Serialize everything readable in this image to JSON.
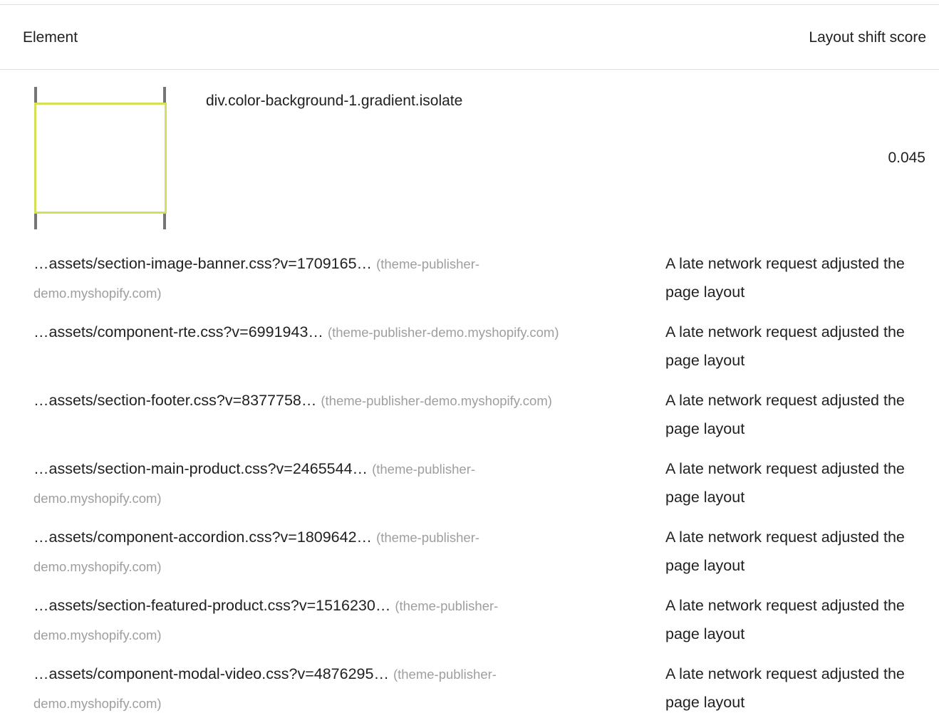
{
  "header": {
    "element_label": "Element",
    "score_label": "Layout shift score"
  },
  "element": {
    "selector": "div.color-background-1.gradient.isolate",
    "score": "0.045",
    "highlight_color": "#d4e157"
  },
  "rows": [
    {
      "url": "…assets/section-image-banner.css?v=1709165…",
      "origin": "(theme-publisher-demo.myshopify.com)",
      "reason": "A late network request adjusted the page layout"
    },
    {
      "url": "…assets/component-rte.css?v=6991943…",
      "origin": "(theme-publisher-demo.myshopify.com)",
      "reason": "A late network request adjusted the page layout"
    },
    {
      "url": "…assets/section-footer.css?v=8377758…",
      "origin": "(theme-publisher-demo.myshopify.com)",
      "reason": "A late network request adjusted the page layout"
    },
    {
      "url": "…assets/section-main-product.css?v=2465544…",
      "origin": "(theme-publisher-demo.myshopify.com)",
      "reason": "A late network request adjusted the page layout"
    },
    {
      "url": "…assets/component-accordion.css?v=1809642…",
      "origin": "(theme-publisher-demo.myshopify.com)",
      "reason": "A late network request adjusted the page layout"
    },
    {
      "url": "…assets/section-featured-product.css?v=1516230…",
      "origin": "(theme-publisher-demo.myshopify.com)",
      "reason": "A late network request adjusted the page layout"
    },
    {
      "url": "…assets/component-modal-video.css?v=4876295…",
      "origin": "(theme-publisher-demo.myshopify.com)",
      "reason": "A late network request adjusted the page layout"
    }
  ]
}
